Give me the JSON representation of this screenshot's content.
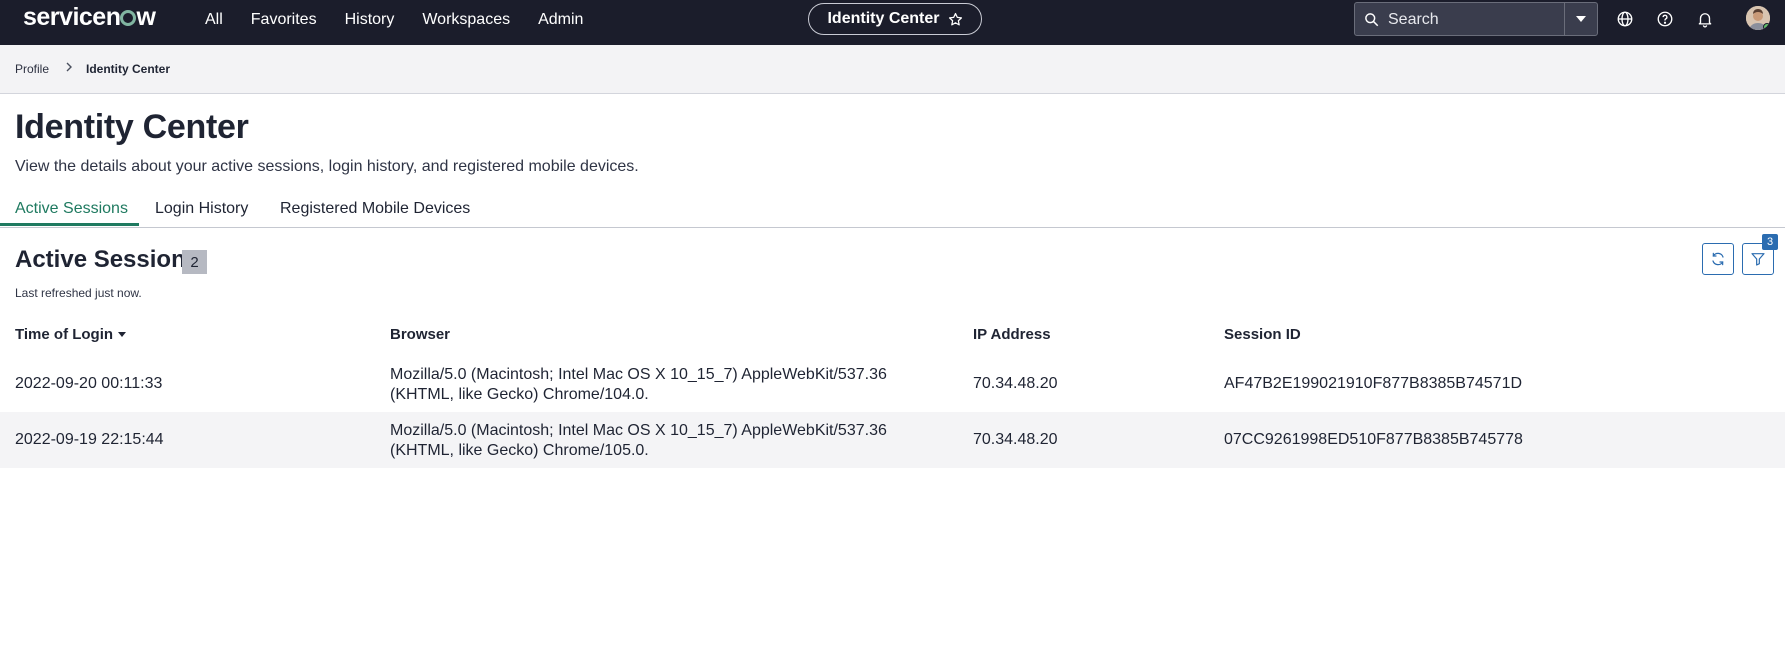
{
  "brand": {
    "logo_text_1": "servicen",
    "logo_text_2": "w"
  },
  "nav": {
    "items": [
      "All",
      "Favorites",
      "History",
      "Workspaces",
      "Admin"
    ],
    "current_page": "Identity Center"
  },
  "search": {
    "placeholder": "Search"
  },
  "icons": {
    "star": "star-icon",
    "search": "search-icon",
    "dropdown": "chevron-down-icon",
    "globe": "globe-icon",
    "help": "help-icon",
    "bell": "bell-icon",
    "refresh": "refresh-icon",
    "filter": "filter-icon"
  },
  "colors": {
    "topbar": "#1b1d2b",
    "accent": "#1f7a60",
    "button": "#2b6cb0"
  },
  "breadcrumb": {
    "items": [
      "Profile",
      "Identity Center"
    ]
  },
  "page": {
    "title": "Identity Center",
    "description": "View the details about your active sessions, login history, and registered mobile devices."
  },
  "tabs": [
    "Active Sessions",
    "Login History",
    "Registered Mobile Devices"
  ],
  "active_tab": "Active Sessions",
  "section": {
    "title": "Active Sessions",
    "count": "2",
    "last_refreshed": "Last refreshed just now.",
    "filter_count": "3"
  },
  "table": {
    "columns": [
      "Time of Login",
      "Browser",
      "IP Address",
      "Session ID"
    ],
    "sorted_by": "Time of Login",
    "rows": [
      {
        "time": "2022-09-20 00:11:33",
        "browser_line1": "Mozilla/5.0 (Macintosh; Intel Mac OS X 10_15_7) AppleWebKit/537.36",
        "browser_line2": "(KHTML, like Gecko) Chrome/104.0.",
        "ip": "70.34.48.20",
        "session_id": "AF47B2E199021910F877B8385B74571D"
      },
      {
        "time": "2022-09-19 22:15:44",
        "browser_line1": "Mozilla/5.0 (Macintosh; Intel Mac OS X 10_15_7) AppleWebKit/537.36",
        "browser_line2": "(KHTML, like Gecko) Chrome/105.0.",
        "ip": "70.34.48.20",
        "session_id": "07CC9261998ED510F877B8385B745778"
      }
    ]
  }
}
